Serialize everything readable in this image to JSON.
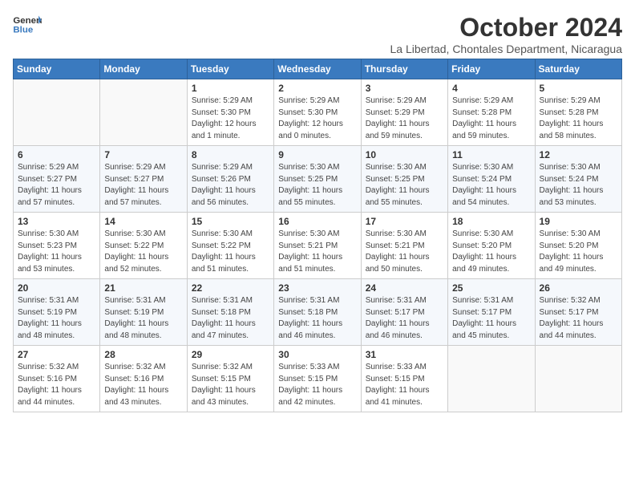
{
  "header": {
    "logo_line1": "General",
    "logo_line2": "Blue",
    "month_title": "October 2024",
    "subtitle": "La Libertad, Chontales Department, Nicaragua"
  },
  "weekdays": [
    "Sunday",
    "Monday",
    "Tuesday",
    "Wednesday",
    "Thursday",
    "Friday",
    "Saturday"
  ],
  "weeks": [
    [
      {
        "day": "",
        "sunrise": "",
        "sunset": "",
        "daylight": ""
      },
      {
        "day": "",
        "sunrise": "",
        "sunset": "",
        "daylight": ""
      },
      {
        "day": "1",
        "sunrise": "Sunrise: 5:29 AM",
        "sunset": "Sunset: 5:30 PM",
        "daylight": "Daylight: 12 hours and 1 minute."
      },
      {
        "day": "2",
        "sunrise": "Sunrise: 5:29 AM",
        "sunset": "Sunset: 5:30 PM",
        "daylight": "Daylight: 12 hours and 0 minutes."
      },
      {
        "day": "3",
        "sunrise": "Sunrise: 5:29 AM",
        "sunset": "Sunset: 5:29 PM",
        "daylight": "Daylight: 11 hours and 59 minutes."
      },
      {
        "day": "4",
        "sunrise": "Sunrise: 5:29 AM",
        "sunset": "Sunset: 5:28 PM",
        "daylight": "Daylight: 11 hours and 59 minutes."
      },
      {
        "day": "5",
        "sunrise": "Sunrise: 5:29 AM",
        "sunset": "Sunset: 5:28 PM",
        "daylight": "Daylight: 11 hours and 58 minutes."
      }
    ],
    [
      {
        "day": "6",
        "sunrise": "Sunrise: 5:29 AM",
        "sunset": "Sunset: 5:27 PM",
        "daylight": "Daylight: 11 hours and 57 minutes."
      },
      {
        "day": "7",
        "sunrise": "Sunrise: 5:29 AM",
        "sunset": "Sunset: 5:27 PM",
        "daylight": "Daylight: 11 hours and 57 minutes."
      },
      {
        "day": "8",
        "sunrise": "Sunrise: 5:29 AM",
        "sunset": "Sunset: 5:26 PM",
        "daylight": "Daylight: 11 hours and 56 minutes."
      },
      {
        "day": "9",
        "sunrise": "Sunrise: 5:30 AM",
        "sunset": "Sunset: 5:25 PM",
        "daylight": "Daylight: 11 hours and 55 minutes."
      },
      {
        "day": "10",
        "sunrise": "Sunrise: 5:30 AM",
        "sunset": "Sunset: 5:25 PM",
        "daylight": "Daylight: 11 hours and 55 minutes."
      },
      {
        "day": "11",
        "sunrise": "Sunrise: 5:30 AM",
        "sunset": "Sunset: 5:24 PM",
        "daylight": "Daylight: 11 hours and 54 minutes."
      },
      {
        "day": "12",
        "sunrise": "Sunrise: 5:30 AM",
        "sunset": "Sunset: 5:24 PM",
        "daylight": "Daylight: 11 hours and 53 minutes."
      }
    ],
    [
      {
        "day": "13",
        "sunrise": "Sunrise: 5:30 AM",
        "sunset": "Sunset: 5:23 PM",
        "daylight": "Daylight: 11 hours and 53 minutes."
      },
      {
        "day": "14",
        "sunrise": "Sunrise: 5:30 AM",
        "sunset": "Sunset: 5:22 PM",
        "daylight": "Daylight: 11 hours and 52 minutes."
      },
      {
        "day": "15",
        "sunrise": "Sunrise: 5:30 AM",
        "sunset": "Sunset: 5:22 PM",
        "daylight": "Daylight: 11 hours and 51 minutes."
      },
      {
        "day": "16",
        "sunrise": "Sunrise: 5:30 AM",
        "sunset": "Sunset: 5:21 PM",
        "daylight": "Daylight: 11 hours and 51 minutes."
      },
      {
        "day": "17",
        "sunrise": "Sunrise: 5:30 AM",
        "sunset": "Sunset: 5:21 PM",
        "daylight": "Daylight: 11 hours and 50 minutes."
      },
      {
        "day": "18",
        "sunrise": "Sunrise: 5:30 AM",
        "sunset": "Sunset: 5:20 PM",
        "daylight": "Daylight: 11 hours and 49 minutes."
      },
      {
        "day": "19",
        "sunrise": "Sunrise: 5:30 AM",
        "sunset": "Sunset: 5:20 PM",
        "daylight": "Daylight: 11 hours and 49 minutes."
      }
    ],
    [
      {
        "day": "20",
        "sunrise": "Sunrise: 5:31 AM",
        "sunset": "Sunset: 5:19 PM",
        "daylight": "Daylight: 11 hours and 48 minutes."
      },
      {
        "day": "21",
        "sunrise": "Sunrise: 5:31 AM",
        "sunset": "Sunset: 5:19 PM",
        "daylight": "Daylight: 11 hours and 48 minutes."
      },
      {
        "day": "22",
        "sunrise": "Sunrise: 5:31 AM",
        "sunset": "Sunset: 5:18 PM",
        "daylight": "Daylight: 11 hours and 47 minutes."
      },
      {
        "day": "23",
        "sunrise": "Sunrise: 5:31 AM",
        "sunset": "Sunset: 5:18 PM",
        "daylight": "Daylight: 11 hours and 46 minutes."
      },
      {
        "day": "24",
        "sunrise": "Sunrise: 5:31 AM",
        "sunset": "Sunset: 5:17 PM",
        "daylight": "Daylight: 11 hours and 46 minutes."
      },
      {
        "day": "25",
        "sunrise": "Sunrise: 5:31 AM",
        "sunset": "Sunset: 5:17 PM",
        "daylight": "Daylight: 11 hours and 45 minutes."
      },
      {
        "day": "26",
        "sunrise": "Sunrise: 5:32 AM",
        "sunset": "Sunset: 5:17 PM",
        "daylight": "Daylight: 11 hours and 44 minutes."
      }
    ],
    [
      {
        "day": "27",
        "sunrise": "Sunrise: 5:32 AM",
        "sunset": "Sunset: 5:16 PM",
        "daylight": "Daylight: 11 hours and 44 minutes."
      },
      {
        "day": "28",
        "sunrise": "Sunrise: 5:32 AM",
        "sunset": "Sunset: 5:16 PM",
        "daylight": "Daylight: 11 hours and 43 minutes."
      },
      {
        "day": "29",
        "sunrise": "Sunrise: 5:32 AM",
        "sunset": "Sunset: 5:15 PM",
        "daylight": "Daylight: 11 hours and 43 minutes."
      },
      {
        "day": "30",
        "sunrise": "Sunrise: 5:33 AM",
        "sunset": "Sunset: 5:15 PM",
        "daylight": "Daylight: 11 hours and 42 minutes."
      },
      {
        "day": "31",
        "sunrise": "Sunrise: 5:33 AM",
        "sunset": "Sunset: 5:15 PM",
        "daylight": "Daylight: 11 hours and 41 minutes."
      },
      {
        "day": "",
        "sunrise": "",
        "sunset": "",
        "daylight": ""
      },
      {
        "day": "",
        "sunrise": "",
        "sunset": "",
        "daylight": ""
      }
    ]
  ]
}
